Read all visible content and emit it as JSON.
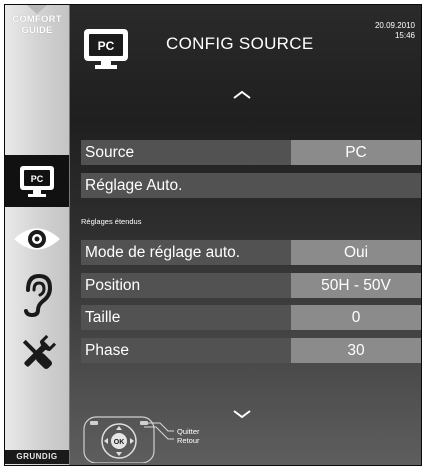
{
  "sidebar": {
    "comfort_guide": [
      "COMFORT",
      "GUIDE"
    ],
    "items": [
      {
        "icon": "pc-icon",
        "selected": true
      },
      {
        "icon": "eye-icon",
        "selected": false
      },
      {
        "icon": "ear-icon",
        "selected": false
      },
      {
        "icon": "tools-icon",
        "selected": false
      }
    ],
    "brand": "GRUNDIG"
  },
  "header": {
    "icon_label": "PC",
    "title": "CONFIG SOURCE",
    "date": "20.09.2010",
    "time": "15:46"
  },
  "menu": {
    "rows": [
      {
        "label": "Source",
        "value": "PC"
      },
      {
        "label": "Réglage Auto."
      }
    ],
    "section_label": "Réglages étendus",
    "extended_rows": [
      {
        "label": "Mode de réglage auto.",
        "value": "Oui"
      },
      {
        "label": "Position",
        "value": "50H - 50V"
      },
      {
        "label": "Taille",
        "value": "0"
      },
      {
        "label": "Phase",
        "value": "30"
      }
    ]
  },
  "footer": {
    "ok_label": "OK",
    "hint_quit": "Quitter",
    "hint_back": "Retour"
  },
  "colors": {
    "sidebar_bg": "#d6d6d6",
    "panel_bg": "#1f1f1f",
    "row_label_bg": "#525252",
    "row_value_bg": "#8b8b8b",
    "text": "#ffffff"
  }
}
